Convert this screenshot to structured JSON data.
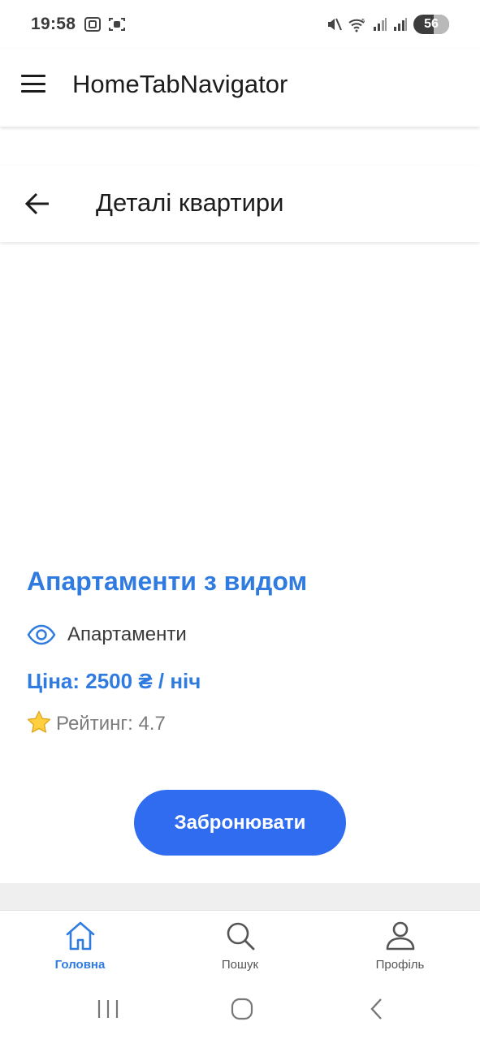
{
  "status_bar": {
    "time": "19:58",
    "battery": "56",
    "battery_level_pct": 56,
    "icons": [
      "screenshot-icon",
      "scan-icon",
      "mute-icon",
      "wifi-icon",
      "signal-icon",
      "signal-icon",
      "battery-icon"
    ]
  },
  "app_header": {
    "title": "HomeTabNavigator",
    "menu_icon": "hamburger-menu-icon"
  },
  "stack_header": {
    "title": "Деталі квартири",
    "back_icon": "arrow-left-icon"
  },
  "apartment": {
    "title": "Апартаменти з видом",
    "type_icon": "eye-icon",
    "type": "Апартаменти",
    "price": "Ціна: 2500 ₴ / ніч",
    "rating_icon": "star-icon",
    "rating": "Рейтинг: 4.7"
  },
  "actions": {
    "book_label": "Забронювати"
  },
  "tabs": [
    {
      "label": "Головна",
      "icon": "home-icon",
      "active": true
    },
    {
      "label": "Пошук",
      "icon": "search-icon",
      "active": false
    },
    {
      "label": "Профіль",
      "icon": "profile-icon",
      "active": false
    }
  ],
  "colors": {
    "accent": "#2f7be0",
    "button": "#2f6cf0",
    "gap": "#efefef"
  }
}
